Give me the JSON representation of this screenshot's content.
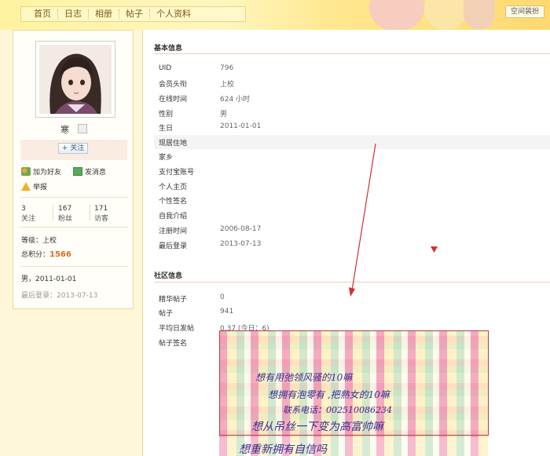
{
  "nav": {
    "items": [
      "首页",
      "日志",
      "相册",
      "帖子",
      "个人资料"
    ]
  },
  "header": {
    "skin_button": "空间装扮"
  },
  "profile": {
    "username": "寒",
    "follow_label": "+ 关注",
    "actions": {
      "add_friend": "加为好友",
      "send_message": "发消息",
      "report": "举报"
    },
    "stats": [
      {
        "value": "3",
        "label": "关注"
      },
      {
        "value": "167",
        "label": "粉丝"
      },
      {
        "value": "171",
        "label": "访客"
      }
    ],
    "level_label": "等级：",
    "level_value": "上校",
    "points_label": "总积分：",
    "points_value": "1566",
    "gender_birth": "男，2011-01-01",
    "last_login": "最后登录：2013-07-13"
  },
  "basic": {
    "title": "基本信息",
    "rows": [
      {
        "k": "UID",
        "v": "796"
      },
      {
        "k": "会员头衔",
        "v": "上校"
      },
      {
        "k": "在线时间",
        "v": "624 小时"
      },
      {
        "k": "性别",
        "v": "男"
      },
      {
        "k": "生日",
        "v": "2011-01-01"
      },
      {
        "k": "现居住地",
        "v": ""
      },
      {
        "k": "家乡",
        "v": ""
      },
      {
        "k": "支付宝账号",
        "v": ""
      },
      {
        "k": "个人主页",
        "v": ""
      },
      {
        "k": "个性签名",
        "v": ""
      },
      {
        "k": "自我介绍",
        "v": ""
      },
      {
        "k": "注册时间",
        "v": "2006-08-17"
      },
      {
        "k": "最后登录",
        "v": "2013-07-13"
      }
    ]
  },
  "community": {
    "title": "社区信息",
    "rows": [
      {
        "k": "精华帖子",
        "v": "0"
      },
      {
        "k": "帖子",
        "v": "941"
      },
      {
        "k": "平均日发帖",
        "v": "0.37 (今日：6)"
      },
      {
        "k": "帖子签名",
        "v": ""
      }
    ]
  },
  "signature": {
    "line1": "想有用弛领风骚的10嘛",
    "line2": "想拥有泡零有 ,把熟女的10嘛",
    "line3": "联系电话：002510086234",
    "line4": "想从吊丝一下变为高富帅嘛",
    "line5": "想重新拥有自信吗"
  },
  "colors": {
    "accent": "#e06a1a",
    "link": "#2a5a9a",
    "section_rule": "#f3c9b3",
    "annotation": "#d03030"
  }
}
